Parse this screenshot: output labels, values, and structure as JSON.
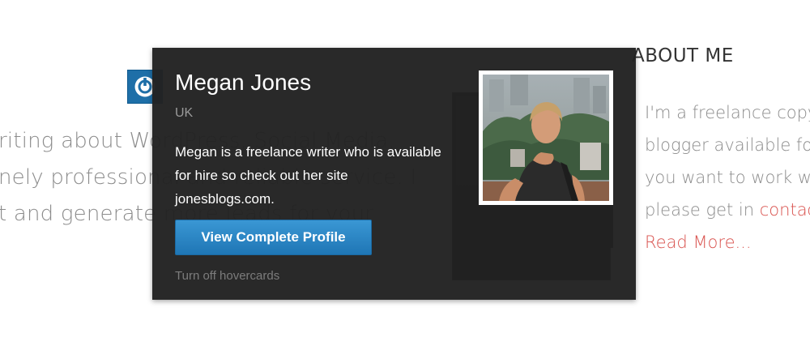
{
  "background": {
    "lines": [
      "riting about WordPress, Social Media,",
      "nely professional and reliable service. I",
      "t and generate more leads for your"
    ]
  },
  "about": {
    "heading": "ABOUT ME",
    "lines": [
      "I'm a freelance copy",
      "blogger available fo",
      "you want to work w",
      "please get in "
    ],
    "contact_link": "contac",
    "read_more": "Read More..."
  },
  "hovercard": {
    "name": "Megan Jones",
    "location": "UK",
    "bio": "Megan is a freelance writer who is available for hire so check out her site jonesblogs.com.",
    "button_label": "View Complete Profile",
    "turn_off_label": "Turn off hovercards"
  },
  "icons": {
    "logo": "gravatar-power-icon"
  },
  "colors": {
    "card_background": "#222222",
    "button_blue": "#2a86c6",
    "link_red": "#d9534f"
  }
}
